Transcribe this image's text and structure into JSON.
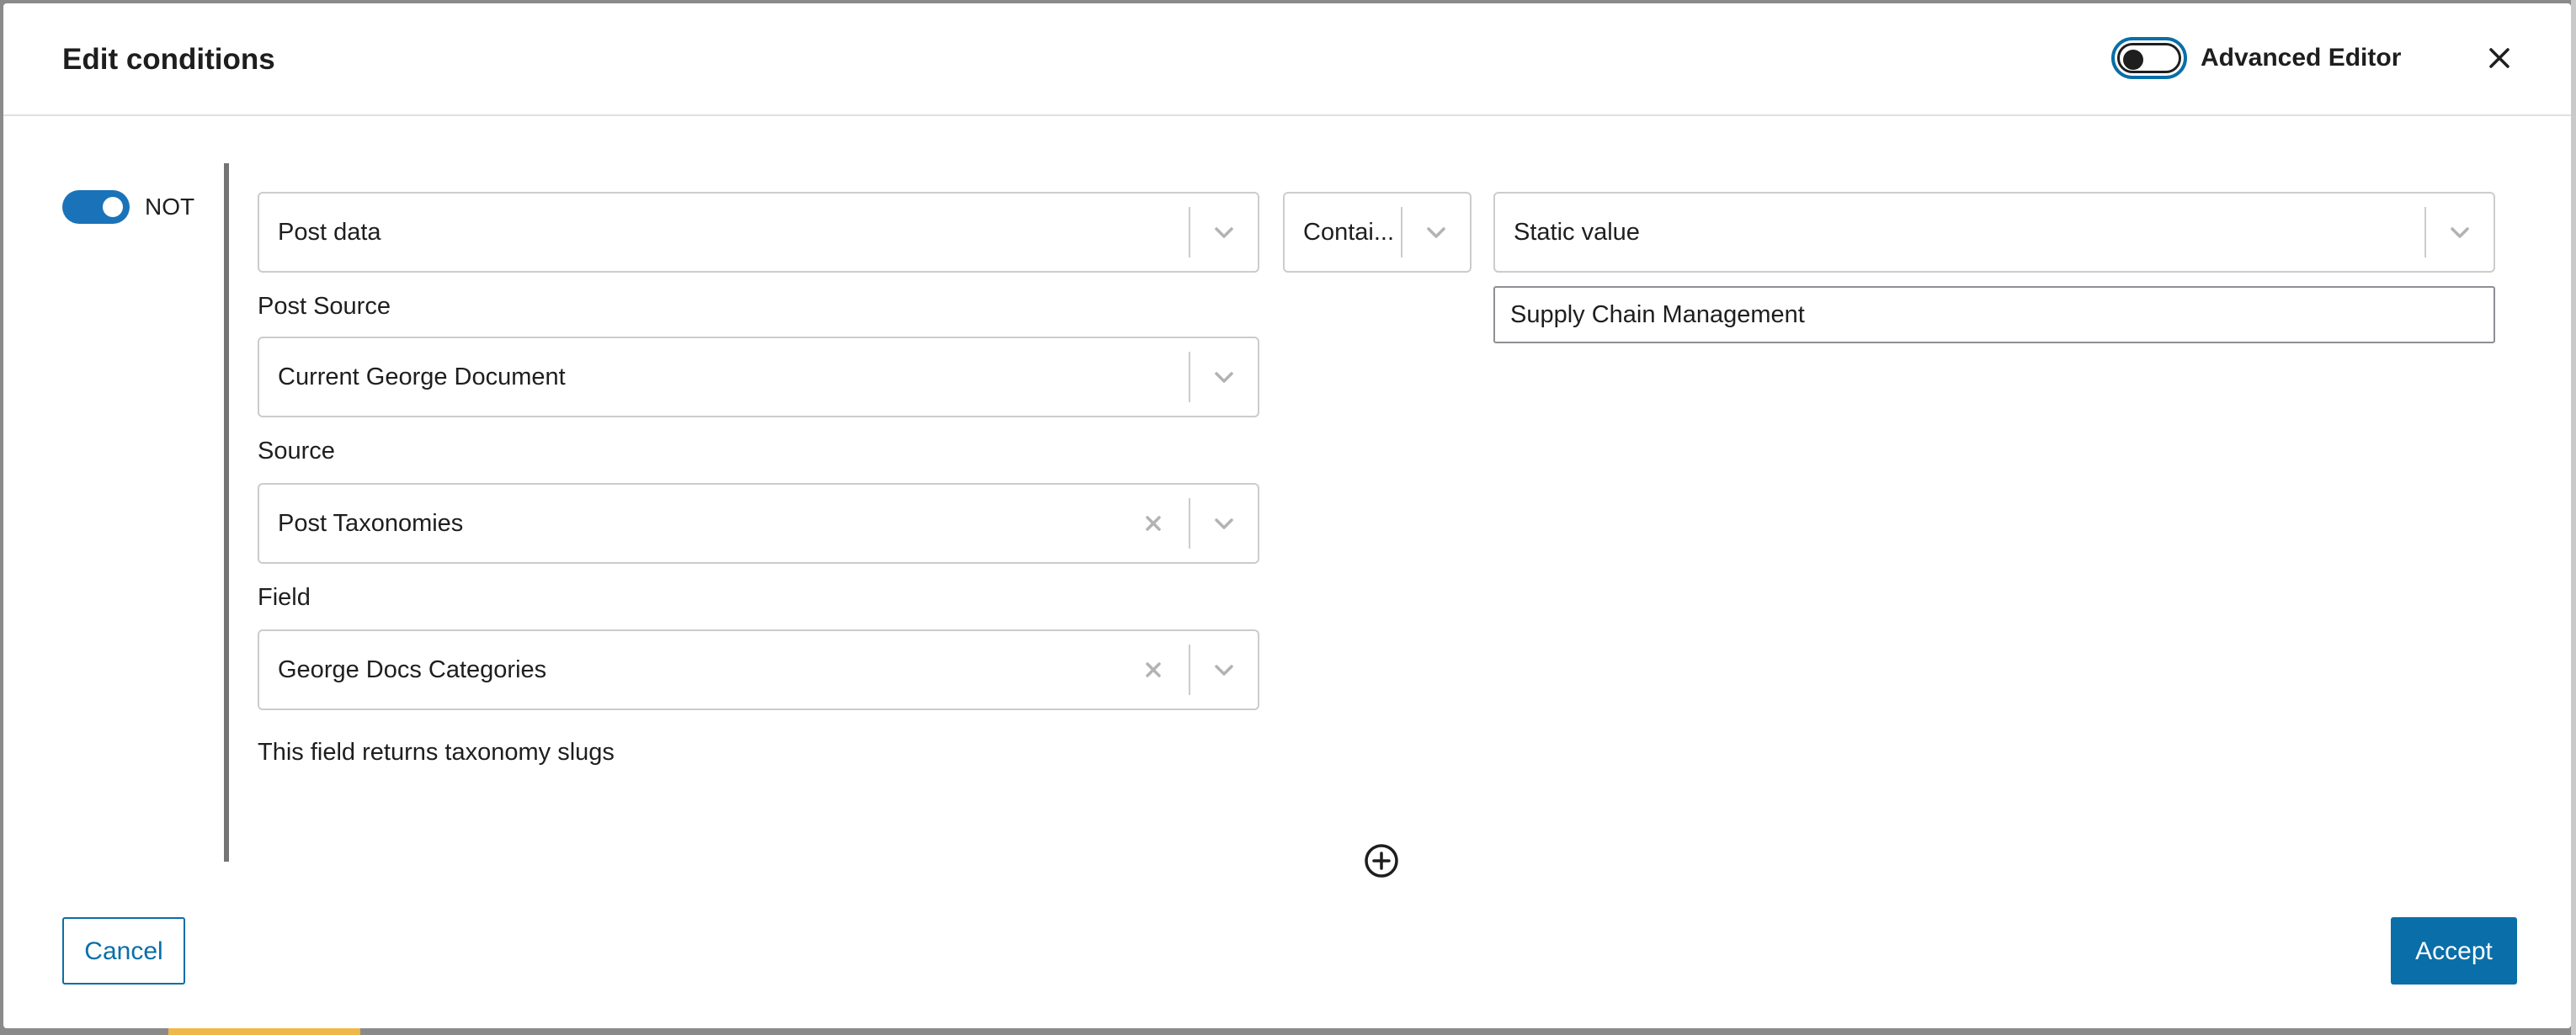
{
  "modal": {
    "title": "Edit conditions",
    "advanced_editor_label": "Advanced Editor",
    "advanced_editor_on": false,
    "close_icon": "close-icon"
  },
  "condition": {
    "not_label": "NOT",
    "not_on": true,
    "subject": {
      "value": "Post data"
    },
    "post_source": {
      "label": "Post Source",
      "value": "Current George Document"
    },
    "source": {
      "label": "Source",
      "value": "Post Taxonomies"
    },
    "field": {
      "label": "Field",
      "value": "George Docs Categories"
    },
    "help_text": "This field returns taxonomy slugs",
    "operator": {
      "value": "Contai..."
    },
    "value_type": {
      "value": "Static value"
    },
    "value_input": "Supply Chain Management"
  },
  "footer": {
    "cancel_label": "Cancel",
    "accept_label": "Accept"
  },
  "colors": {
    "accent": "#0a6ea8",
    "toggle_on": "#1a73b8",
    "border": "#cccccc"
  }
}
